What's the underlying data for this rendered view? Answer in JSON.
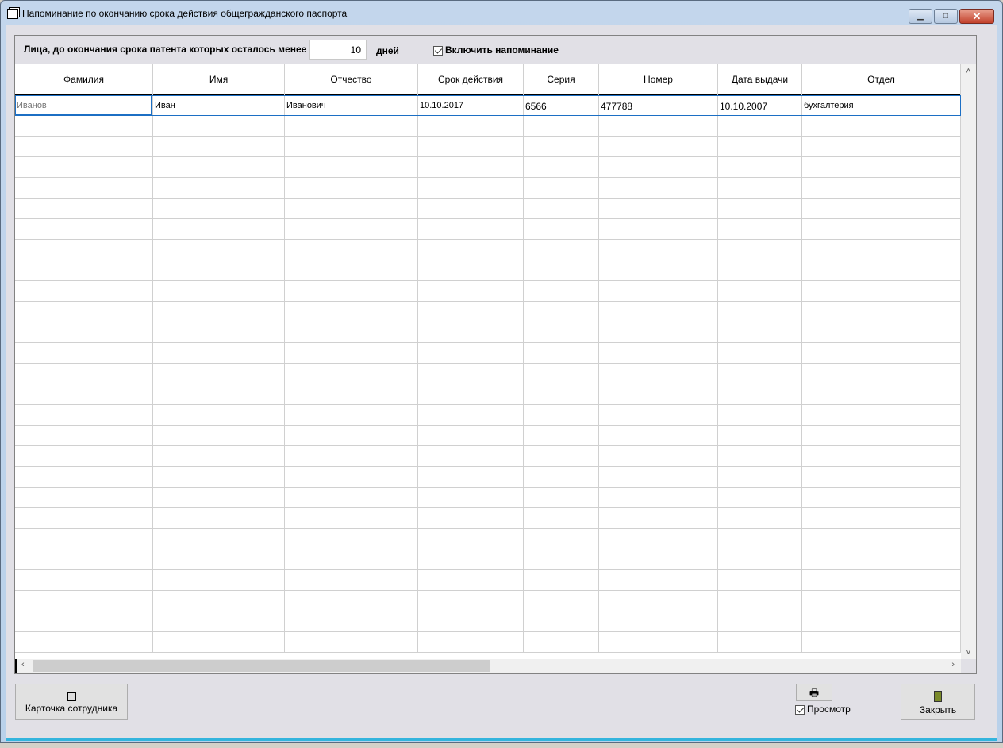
{
  "window": {
    "title": "Напоминание по окончанию срока действия общегражданского паспорта",
    "minimize": "▁",
    "maximize": "□",
    "close": "✕"
  },
  "filter": {
    "label": "Лица, до окончания срока патента которых осталось менее",
    "days_value": "10",
    "days_label": "дней",
    "reminder_label": "Включить напоминание",
    "reminder_checked": true
  },
  "table": {
    "columns": [
      "Фамилия",
      "Имя",
      "Отчество",
      "Срок действия",
      "Серия",
      "Номер",
      "Дата выдачи",
      "Отдел"
    ],
    "rows": [
      [
        "Иванов",
        "Иван",
        "Иванович",
        "10.10.2017",
        "6566",
        "477788",
        "10.10.2007",
        "бухгалтерия"
      ]
    ],
    "empty_rows": 26
  },
  "buttons": {
    "employee_card": "Карточка сотрудника",
    "preview_label": "Просмотр",
    "preview_checked": true,
    "close": "Закрыть"
  }
}
